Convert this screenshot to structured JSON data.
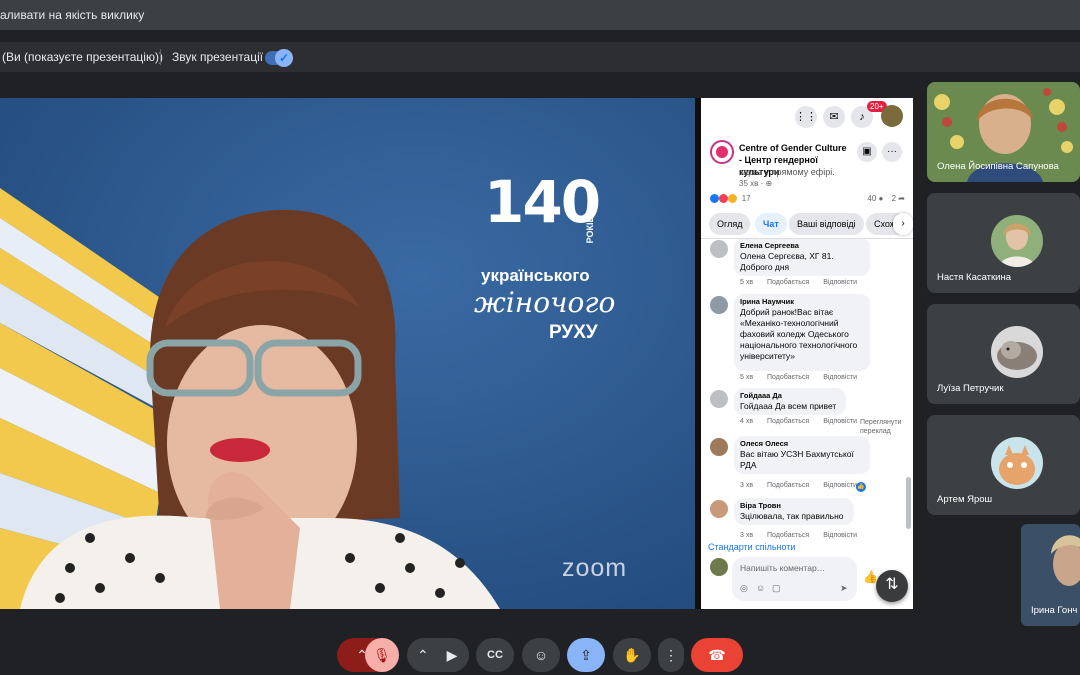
{
  "topbar": {
    "title": "аливати на якість виклику"
  },
  "presenting_bar": {
    "presenting_text": "(Ви (показуєте презентацію))",
    "sound_label": "Звук презентації",
    "sound_enabled": true
  },
  "slide": {
    "number": "140",
    "years": "РОКІВ",
    "line1": "українського",
    "line2": "жіночого",
    "line3": "РУХУ",
    "watermark": "ZOOM"
  },
  "facebook": {
    "notif_badge": "20+",
    "page_name": "Centre of Gender Culture - Центр гендерної культури",
    "live_status": "зараз у прямому ефірі.",
    "time": "35 хв · ⊕",
    "reactions_count": "17",
    "comments_count": "40",
    "shares_count": "2",
    "tabs": [
      "Огляд",
      "Чат",
      "Ваші відповіді",
      "Схоже"
    ],
    "active_tab": "Чат",
    "comments": [
      {
        "name": "Елена Сергеева",
        "text": "Олена Сергєєва, ХГ 81. Доброго дня",
        "time": "5 хв",
        "like": "Подобається",
        "reply": "Відповісти"
      },
      {
        "name": "Ірина Наумчик",
        "text": "Добрий ранок!Вас вітає «Механіко-технологічний фаховий коледж Одеського національного технологічного університету»",
        "time": "5 хв",
        "like": "Подобається",
        "reply": "Відповісти"
      },
      {
        "name": "Гойдааа Да",
        "text": "Гойдааа Да всем привет",
        "time": "4 хв",
        "like": "Подобається",
        "reply": "Відповісти",
        "translate": "Переглянути переклад"
      },
      {
        "name": "Олеся Олеся",
        "text": "Вас вітаю УСЗН Бахмутської РДА",
        "time": "3 хв",
        "like": "Подобається",
        "reply": "Відповісти"
      },
      {
        "name": "Віра Тровн",
        "text": "Зцілювала, так правильно",
        "time": "3 хв",
        "like": "Подобається",
        "reply": "Відповісти"
      }
    ],
    "community_standards": "Стандарти спільноти",
    "comment_placeholder": "Напишіть коментар…"
  },
  "participants": [
    {
      "name": "Олена Йосипівна Сапунова"
    },
    {
      "name": "Настя Касаткина"
    },
    {
      "name": "Луїза Петручик"
    },
    {
      "name": "Артем Ярош"
    },
    {
      "name": "Ірина Гонч"
    }
  ],
  "colors": {
    "background": "#202124",
    "slide_blue": "#2f5a8f",
    "facebook_blue": "#1877f2",
    "hangup_red": "#ea4335",
    "present_active": "#8ab4f8"
  }
}
